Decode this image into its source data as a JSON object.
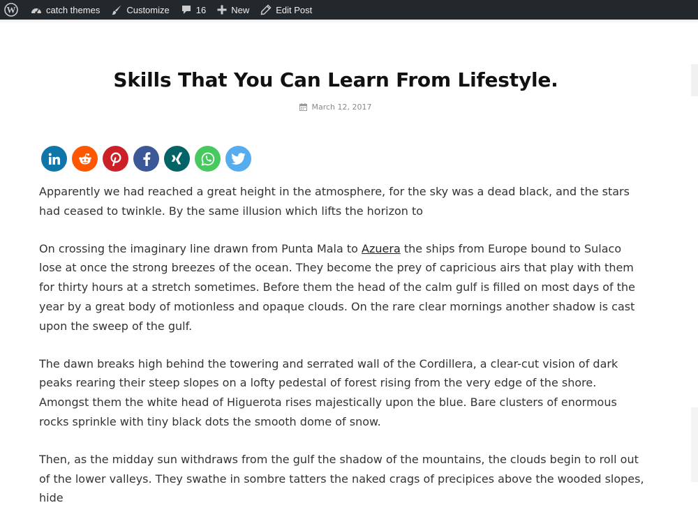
{
  "adminbar": {
    "site_name": "catch themes",
    "customize": "Customize",
    "comments_count": "16",
    "new_label": "New",
    "edit_post": "Edit Post"
  },
  "post": {
    "title": "Skills That You Can Learn From Lifestyle.",
    "date": "March 12, 2017",
    "share_buttons": [
      {
        "network": "linkedin",
        "color": "#0e76a8"
      },
      {
        "network": "reddit",
        "color": "#ff5700"
      },
      {
        "network": "pinterest",
        "color": "#cb2027"
      },
      {
        "network": "facebook",
        "color": "#3b5998"
      },
      {
        "network": "xing",
        "color": "#026466"
      },
      {
        "network": "whatsapp",
        "color": "#48c95f"
      },
      {
        "network": "twitter",
        "color": "#55acee"
      }
    ],
    "p1": "Apparently we had reached a great height in the atmosphere, for the sky was a dead black, and the stars had ceased to twinkle. By the same illusion which lifts the horizon to",
    "p2_before": "On crossing the imaginary line drawn from Punta Mala to ",
    "p2_link": "Azuera",
    "p2_after": " the ships from Europe bound to Sulaco lose at once the strong breezes of the ocean. They become the prey of capricious airs that play with them for thirty hours at a stretch sometimes. Before them the head of the calm gulf is filled on most days of the year by a great body of motionless and opaque clouds. On the rare clear mornings another shadow is cast upon the sweep of the gulf.",
    "p3": "The dawn breaks high behind the towering and serrated wall of the Cordillera, a clear-cut vision of dark peaks rearing their steep slopes on a lofty pedestal of forest rising from the very edge of the shore. Amongst them the white head of Higuerota rises majestically upon the blue. Bare clusters of enormous rocks sprinkle with tiny black dots the smooth dome of snow.",
    "p4": "Then, as the midday sun withdraws from the gulf the shadow of the mountains, the clouds begin to roll out of the lower valleys. They swathe in sombre tatters the naked crags of precipices above the wooded slopes, hide"
  }
}
